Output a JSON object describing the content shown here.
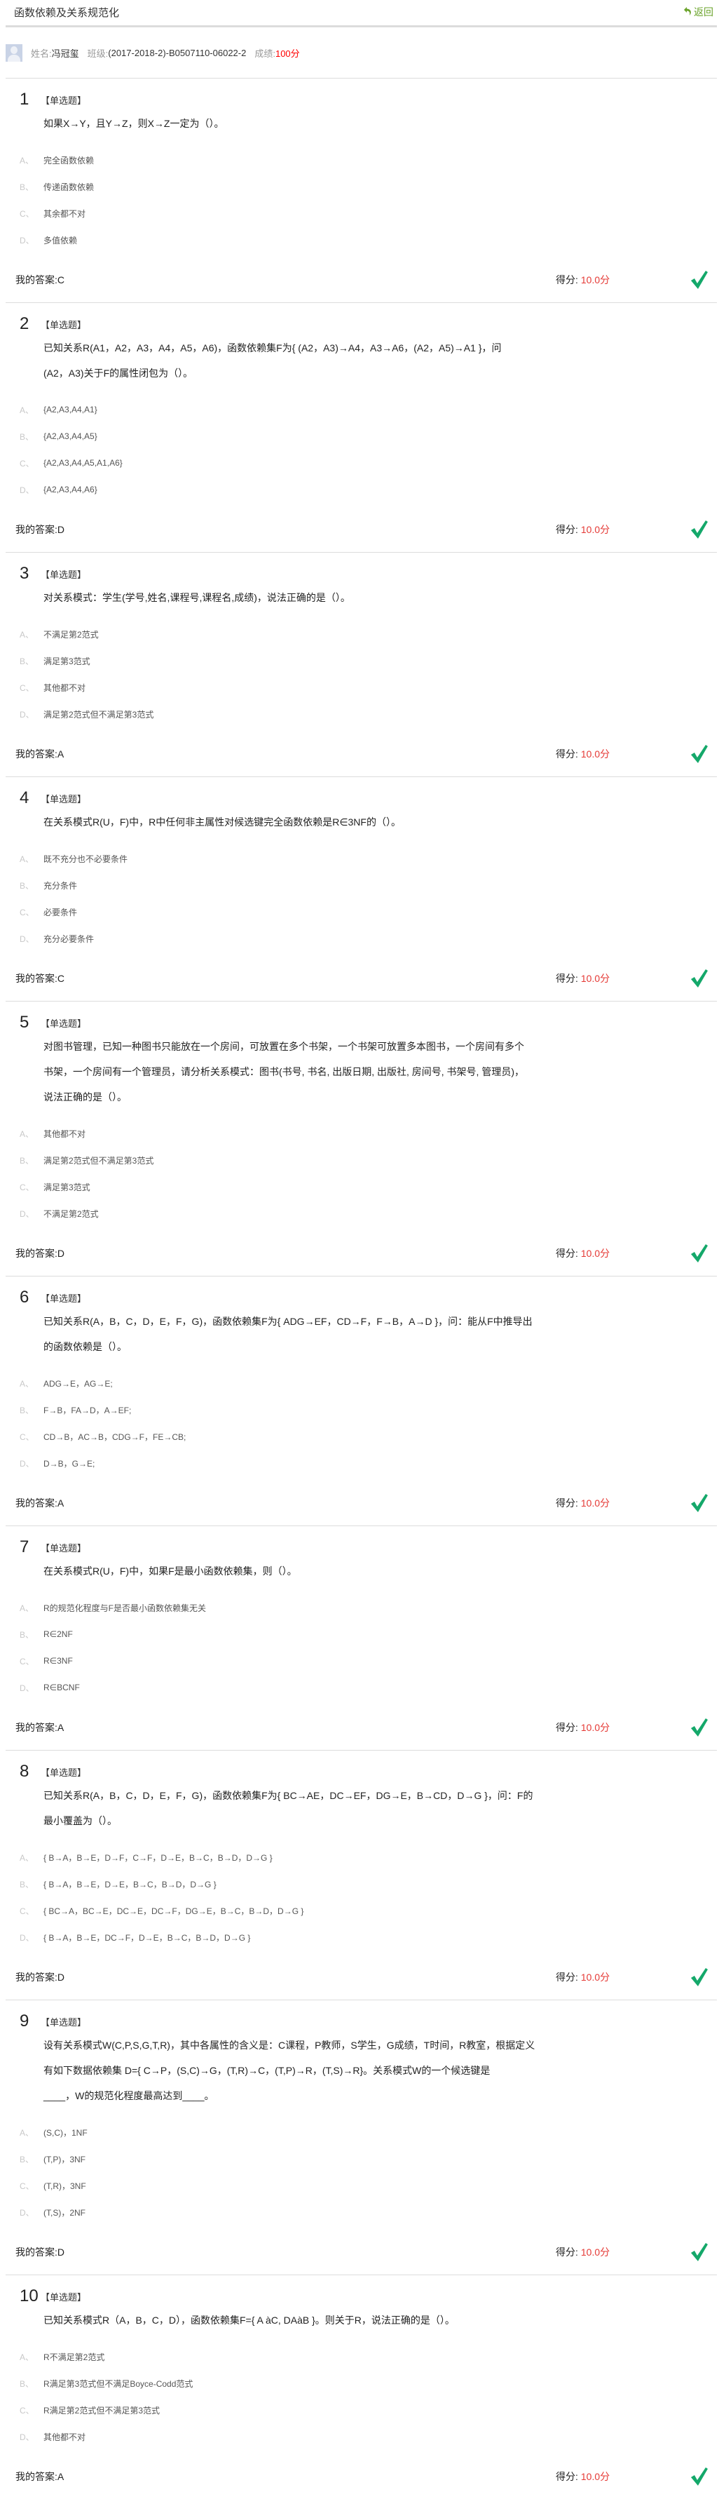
{
  "header": {
    "title": "函数依赖及关系规范化",
    "back_label": "返回"
  },
  "info": {
    "name_label": "姓名:",
    "name": "冯冠玺",
    "class_label": "班级:",
    "class": "(2017-2018-2)-B0507110-06022-2",
    "grade_label": "成绩:",
    "grade": "100分"
  },
  "labels": {
    "my_answer": "我的答案:",
    "score": "得分:"
  },
  "colors": {
    "accent_green": "#6aa32a",
    "check_green": "#14a86a",
    "score_red": "#e53935"
  },
  "questions": [
    {
      "num": "1",
      "type": "【单选题】",
      "lines": [
        "如果X→Y，且Y→Z，则X→Z一定为（）。"
      ],
      "options": [
        {
          "letter": "A、",
          "text": "完全函数依赖"
        },
        {
          "letter": "B、",
          "text": "传递函数依赖"
        },
        {
          "letter": "C、",
          "text": "其余都不对"
        },
        {
          "letter": "D、",
          "text": "多值依赖"
        }
      ],
      "answer": "C",
      "score": "10.0分"
    },
    {
      "num": "2",
      "type": "【单选题】",
      "lines": [
        "已知关系R(A1，A2，A3，A4，A5，A6)，函数依赖集F为{ (A2，A3)→A4，A3→A6，(A2，A5)→A1 }，问",
        "(A2，A3)关于F的属性闭包为（）。"
      ],
      "options": [
        {
          "letter": "A、",
          "text": "{A2,A3,A4,A1}"
        },
        {
          "letter": "B、",
          "text": "{A2,A3,A4,A5}"
        },
        {
          "letter": "C、",
          "text": "{A2,A3,A4,A5,A1,A6}"
        },
        {
          "letter": "D、",
          "text": "{A2,A3,A4,A6}"
        }
      ],
      "answer": "D",
      "score": "10.0分"
    },
    {
      "num": "3",
      "type": "【单选题】",
      "lines": [
        "对关系模式：学生(学号,姓名,课程号,课程名,成绩)，说法正确的是（）。"
      ],
      "options": [
        {
          "letter": "A、",
          "text": "不满足第2范式"
        },
        {
          "letter": "B、",
          "text": "满足第3范式"
        },
        {
          "letter": "C、",
          "text": "其他都不对"
        },
        {
          "letter": "D、",
          "text": "满足第2范式但不满足第3范式"
        }
      ],
      "answer": "A",
      "score": "10.0分"
    },
    {
      "num": "4",
      "type": "【单选题】",
      "lines": [
        "在关系模式R(U，F)中，R中任何非主属性对候选键完全函数依赖是R∈3NF的（）。"
      ],
      "options": [
        {
          "letter": "A、",
          "text": "既不充分也不必要条件"
        },
        {
          "letter": "B、",
          "text": "充分条件"
        },
        {
          "letter": "C、",
          "text": "必要条件"
        },
        {
          "letter": "D、",
          "text": "充分必要条件"
        }
      ],
      "answer": "C",
      "score": "10.0分"
    },
    {
      "num": "5",
      "type": "【单选题】",
      "lines": [
        "对图书管理，已知一种图书只能放在一个房间，可放置在多个书架，一个书架可放置多本图书，一个房间有多个",
        "书架，一个房间有一个管理员，请分析关系模式：图书(书号, 书名, 出版日期, 出版社, 房间号, 书架号, 管理员)，",
        "说法正确的是（）。"
      ],
      "options": [
        {
          "letter": "A、",
          "text": "其他都不对"
        },
        {
          "letter": "B、",
          "text": "满足第2范式但不满足第3范式"
        },
        {
          "letter": "C、",
          "text": "满足第3范式"
        },
        {
          "letter": "D、",
          "text": "不满足第2范式"
        }
      ],
      "answer": "D",
      "score": "10.0分"
    },
    {
      "num": "6",
      "type": "【单选题】",
      "lines": [
        "已知关系R(A，B，C，D，E，F，G)，函数依赖集F为{ ADG→EF，CD→F，F→B，A→D }，问：能从F中推导出",
        "的函数依赖是（）。"
      ],
      "options": [
        {
          "letter": "A、",
          "text": "ADG→E，AG→E;"
        },
        {
          "letter": "B、",
          "text": "F→B，FA→D，A→EF;"
        },
        {
          "letter": "C、",
          "text": "CD→B，AC→B，CDG→F，FE→CB;"
        },
        {
          "letter": "D、",
          "text": "D→B，G→E;"
        }
      ],
      "answer": "A",
      "score": "10.0分"
    },
    {
      "num": "7",
      "type": "【单选题】",
      "lines": [
        "在关系模式R(U，F)中，如果F是最小函数依赖集，则（）。"
      ],
      "options": [
        {
          "letter": "A、",
          "text": "R的规范化程度与F是否最小函数依赖集无关"
        },
        {
          "letter": "B、",
          "text": "R∈2NF"
        },
        {
          "letter": "C、",
          "text": "R∈3NF"
        },
        {
          "letter": "D、",
          "text": "R∈BCNF"
        }
      ],
      "answer": "A",
      "score": "10.0分"
    },
    {
      "num": "8",
      "type": "【单选题】",
      "lines": [
        "已知关系R(A，B，C，D，E，F，G)，函数依赖集F为{ BC→AE，DC→EF，DG→E，B→CD，D→G }，问：F的",
        "最小覆盖为（）。"
      ],
      "options": [
        {
          "letter": "A、",
          "text": "{ B→A，B→E，D→F，C→F，D→E，B→C，B→D，D→G }"
        },
        {
          "letter": "B、",
          "text": "{ B→A，B→E，D→E，B→C，B→D，D→G }"
        },
        {
          "letter": "C、",
          "text": "{ BC→A，BC→E，DC→E，DC→F，DG→E，B→C，B→D，D→G }"
        },
        {
          "letter": "D、",
          "text": "{ B→A，B→E，DC→F，D→E，B→C，B→D，D→G }"
        }
      ],
      "answer": "D",
      "score": "10.0分"
    },
    {
      "num": "9",
      "type": "【单选题】",
      "lines": [
        "设有关系模式W(C,P,S,G,T,R)，其中各属性的含义是：C课程，P教师，S学生，G成绩，T时间，R教室，根据定义",
        "有如下数据依赖集 D={ C→P，(S,C)→G，(T,R)→C，(T,P)→R，(T,S)→R}。关系模式W的一个候选键是",
        "____，W的规范化程度最高达到____。"
      ],
      "options": [
        {
          "letter": "A、",
          "text": "(S,C)，1NF"
        },
        {
          "letter": "B、",
          "text": "(T,P)，3NF"
        },
        {
          "letter": "C、",
          "text": "(T,R)，3NF"
        },
        {
          "letter": "D、",
          "text": "(T,S)，2NF"
        }
      ],
      "answer": "D",
      "score": "10.0分"
    },
    {
      "num": "10",
      "type": "【单选题】",
      "lines": [
        "已知关系模式R（A，B，C，D），函数依赖集F={ A àC, DAàB }。则关于R，说法正确的是（）。"
      ],
      "options": [
        {
          "letter": "A、",
          "text": "R不满足第2范式"
        },
        {
          "letter": "B、",
          "text": "R满足第3范式但不满足Boyce-Codd范式"
        },
        {
          "letter": "C、",
          "text": "R满足第2范式但不满足第3范式"
        },
        {
          "letter": "D、",
          "text": "其他都不对"
        }
      ],
      "answer": "A",
      "score": "10.0分"
    }
  ]
}
